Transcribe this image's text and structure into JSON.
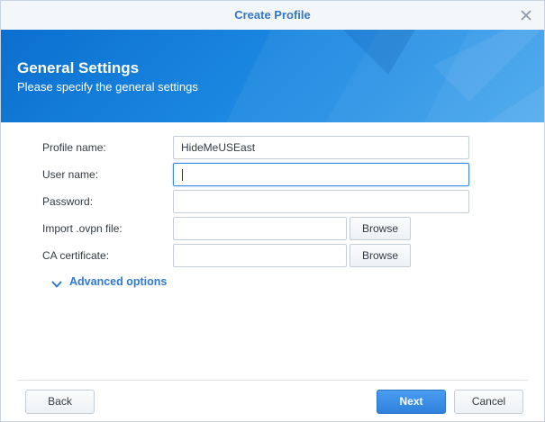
{
  "window": {
    "title": "Create Profile",
    "close_icon": "close-icon"
  },
  "banner": {
    "heading": "General Settings",
    "subheading": "Please specify the general settings"
  },
  "form": {
    "profile_name": {
      "label": "Profile name:",
      "value": "HideMeUSEast"
    },
    "user_name": {
      "label": "User name:",
      "value": ""
    },
    "password": {
      "label": "Password:",
      "value": ""
    },
    "ovpn_file": {
      "label": "Import .ovpn file:",
      "value": "",
      "browse_label": "Browse"
    },
    "ca_certificate": {
      "label": "CA certificate:",
      "value": "",
      "browse_label": "Browse"
    },
    "advanced_options": {
      "label": "Advanced options",
      "icon": "chevron-down-icon"
    }
  },
  "footer": {
    "back_label": "Back",
    "next_label": "Next",
    "cancel_label": "Cancel"
  },
  "colors": {
    "accent": "#3477c6",
    "banner": "#1a86e0",
    "primary_button": "#2f82dc"
  }
}
